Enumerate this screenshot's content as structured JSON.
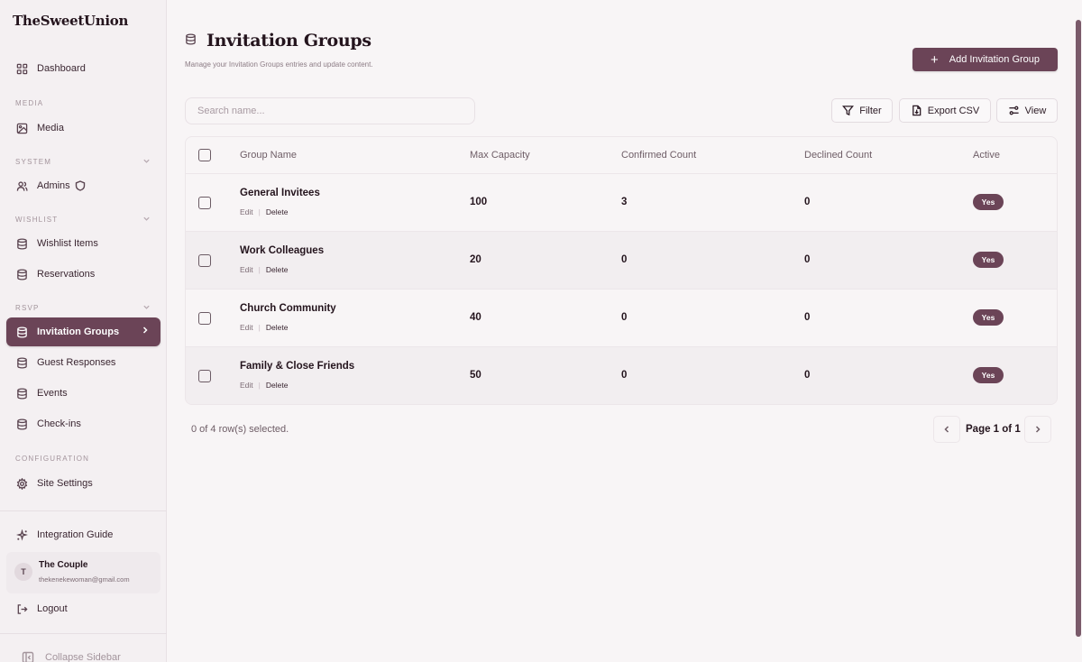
{
  "brand": "TheSweetUnion",
  "sidebar": {
    "dashboard": "Dashboard",
    "sections": {
      "media": "MEDIA",
      "system": "SYSTEM",
      "wishlist": "WISHLIST",
      "rsvp": "RSVP",
      "configuration": "CONFIGURATION"
    },
    "items": {
      "media": "Media",
      "admins": "Admins",
      "wishlist_items": "Wishlist Items",
      "reservations": "Reservations",
      "invitation_groups": "Invitation Groups",
      "guest_responses": "Guest Responses",
      "events": "Events",
      "checkins": "Check-ins",
      "site_settings": "Site Settings",
      "integration_guide": "Integration Guide",
      "logout": "Logout",
      "collapse": "Collapse Sidebar"
    },
    "user": {
      "initial": "T",
      "name": "The Couple",
      "email": "thekenekewoman@gmail.com"
    }
  },
  "header": {
    "title": "Invitation Groups",
    "subtitle": "Manage your Invitation Groups entries and update content.",
    "add_button": "Add Invitation Group"
  },
  "toolbar": {
    "search_placeholder": "Search name...",
    "filter": "Filter",
    "export": "Export CSV",
    "view": "View"
  },
  "table": {
    "columns": [
      "Group Name",
      "Max Capacity",
      "Confirmed Count",
      "Declined Count",
      "Active"
    ],
    "action_edit": "Edit",
    "action_delete": "Delete",
    "rows": [
      {
        "name": "General Invitees",
        "max": "100",
        "confirmed": "3",
        "declined": "0",
        "active": "Yes"
      },
      {
        "name": "Work Colleagues",
        "max": "20",
        "confirmed": "0",
        "declined": "0",
        "active": "Yes"
      },
      {
        "name": "Church Community",
        "max": "40",
        "confirmed": "0",
        "declined": "0",
        "active": "Yes"
      },
      {
        "name": "Family & Close Friends",
        "max": "50",
        "confirmed": "0",
        "declined": "0",
        "active": "Yes"
      }
    ]
  },
  "footer": {
    "selected": "0 of 4 row(s) selected.",
    "page": "Page 1 of 1"
  },
  "colors": {
    "accent": "#6b4457",
    "background": "#f8f5f6"
  }
}
